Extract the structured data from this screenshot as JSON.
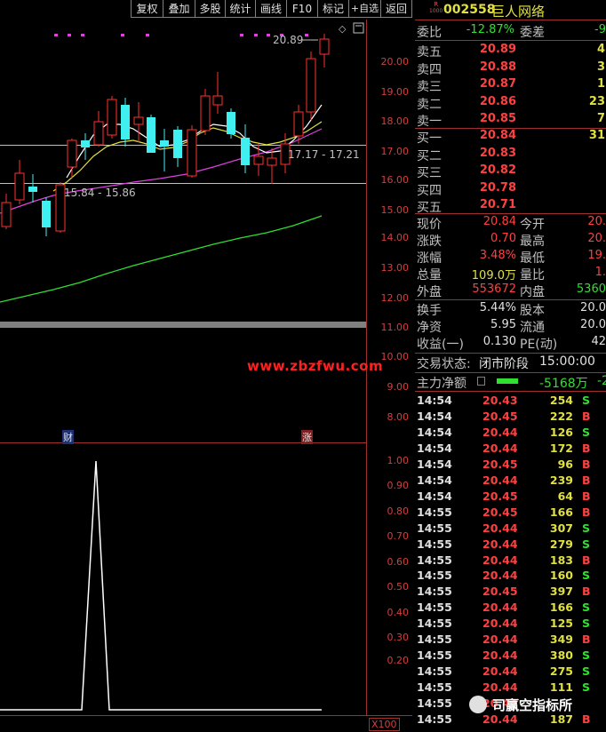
{
  "toolbar": {
    "buttons": [
      "复权",
      "叠加",
      "多股",
      "统计",
      "画线",
      "F10",
      "标记",
      "+自选",
      "返回"
    ]
  },
  "chart": {
    "price_axis": [
      "20.00",
      "19.00",
      "18.00",
      "17.00",
      "16.00",
      "15.00",
      "14.00",
      "13.00",
      "12.00",
      "11.00",
      "10.00",
      "9.00",
      "8.00"
    ],
    "annotations": {
      "high": "20.89",
      "mid": "17.17 - 17.21",
      "low": "15.84 - 15.86"
    },
    "watermark": "www.zbzfwu.com",
    "markers": {
      "cai": "财",
      "zhang": "涨"
    },
    "indicator_axis": [
      "1.00",
      "0.90",
      "0.80",
      "0.70",
      "0.60",
      "0.50",
      "0.40",
      "0.30",
      "0.20"
    ],
    "indicator_unit": "X100",
    "colors": {
      "up": "#ff3030",
      "down": "#40f0f0",
      "ma5": "#ffffff",
      "ma10": "#e0e040",
      "ma20": "#e040e0",
      "ma60": "#30e030"
    }
  },
  "stock": {
    "badge_top": "R",
    "badge_bottom": "1000",
    "code": "002558",
    "name": "巨人网络"
  },
  "order_ratio": {
    "label": "委比",
    "value": "-12.87%",
    "diff_label": "委差",
    "diff_value": "-9"
  },
  "asks": [
    {
      "label": "卖五",
      "price": "20.89",
      "vol": "4"
    },
    {
      "label": "卖四",
      "price": "20.88",
      "vol": "3"
    },
    {
      "label": "卖三",
      "price": "20.87",
      "vol": "1"
    },
    {
      "label": "卖二",
      "price": "20.86",
      "vol": "23"
    },
    {
      "label": "卖一",
      "price": "20.85",
      "vol": "7"
    }
  ],
  "bids": [
    {
      "label": "买一",
      "price": "20.84",
      "vol": "31"
    },
    {
      "label": "买二",
      "price": "20.83",
      "vol": ""
    },
    {
      "label": "买三",
      "price": "20.82",
      "vol": ""
    },
    {
      "label": "买四",
      "price": "20.78",
      "vol": ""
    },
    {
      "label": "买五",
      "price": "20.71",
      "vol": ""
    }
  ],
  "quote": [
    {
      "l1": "现价",
      "v1": "20.84",
      "c1": "red",
      "l2": "今开",
      "v2": "20.",
      "c2": "red"
    },
    {
      "l1": "涨跌",
      "v1": "0.70",
      "c1": "red",
      "l2": "最高",
      "v2": "20.",
      "c2": "red"
    },
    {
      "l1": "涨幅",
      "v1": "3.48%",
      "c1": "red",
      "l2": "最低",
      "v2": "19.",
      "c2": "red"
    },
    {
      "l1": "总量",
      "v1": "109.0万",
      "c1": "yellow",
      "l2": "量比",
      "v2": "1.",
      "c2": "red"
    },
    {
      "l1": "外盘",
      "v1": "553672",
      "c1": "red",
      "l2": "内盘",
      "v2": "5360",
      "c2": "green"
    }
  ],
  "finance": [
    {
      "l1": "换手",
      "v1": "5.44%",
      "l2": "股本",
      "v2": "20.0"
    },
    {
      "l1": "净资",
      "v1": "5.95",
      "l2": "流通",
      "v2": "20.0"
    },
    {
      "l1": "收益(一)",
      "v1": "0.130",
      "l2": "PE(动)",
      "v2": "42"
    }
  ],
  "status": {
    "label": "交易状态:",
    "value": "闭市阶段",
    "time": "15:00:00"
  },
  "main_net": {
    "label": "主力净额",
    "value": "-5168万",
    "extra": "-2"
  },
  "ticks": [
    {
      "t": "14:54",
      "p": "20.43",
      "v": "254",
      "s": "S"
    },
    {
      "t": "14:54",
      "p": "20.45",
      "v": "222",
      "s": "B"
    },
    {
      "t": "14:54",
      "p": "20.44",
      "v": "126",
      "s": "S"
    },
    {
      "t": "14:54",
      "p": "20.44",
      "v": "172",
      "s": "B"
    },
    {
      "t": "14:54",
      "p": "20.45",
      "v": "96",
      "s": "B"
    },
    {
      "t": "14:54",
      "p": "20.44",
      "v": "239",
      "s": "B"
    },
    {
      "t": "14:54",
      "p": "20.45",
      "v": "64",
      "s": "B"
    },
    {
      "t": "14:55",
      "p": "20.45",
      "v": "166",
      "s": "B"
    },
    {
      "t": "14:55",
      "p": "20.44",
      "v": "307",
      "s": "S"
    },
    {
      "t": "14:55",
      "p": "20.44",
      "v": "279",
      "s": "S"
    },
    {
      "t": "14:55",
      "p": "20.44",
      "v": "183",
      "s": "B"
    },
    {
      "t": "14:55",
      "p": "20.44",
      "v": "160",
      "s": "S"
    },
    {
      "t": "14:55",
      "p": "20.45",
      "v": "397",
      "s": "B"
    },
    {
      "t": "14:55",
      "p": "20.44",
      "v": "166",
      "s": "S"
    },
    {
      "t": "14:55",
      "p": "20.44",
      "v": "125",
      "s": "S"
    },
    {
      "t": "14:55",
      "p": "20.44",
      "v": "349",
      "s": "B"
    },
    {
      "t": "14:55",
      "p": "20.44",
      "v": "380",
      "s": "S"
    },
    {
      "t": "14:55",
      "p": "20.44",
      "v": "275",
      "s": "S"
    },
    {
      "t": "14:55",
      "p": "20.44",
      "v": "111",
      "s": "S"
    },
    {
      "t": "14:55",
      "p": "20.44",
      "v": "",
      "s": ""
    },
    {
      "t": "14:55",
      "p": "20.44",
      "v": "187",
      "s": "B"
    }
  ],
  "overlay_brand": "司赢空指标所"
}
